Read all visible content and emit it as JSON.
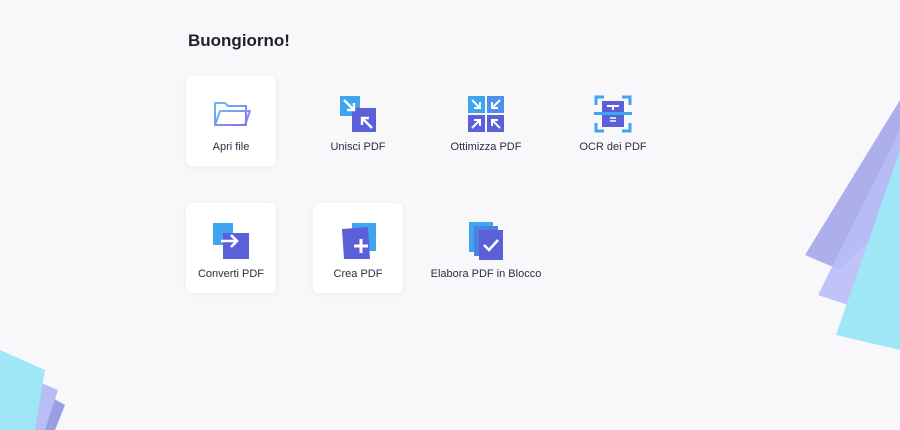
{
  "greeting": "Buongiorno!",
  "tiles": [
    {
      "label": "Apri file",
      "icon": "folder-icon"
    },
    {
      "label": "Unisci PDF",
      "icon": "merge-icon"
    },
    {
      "label": "Ottimizza PDF",
      "icon": "optimize-icon"
    },
    {
      "label": "OCR dei PDF",
      "icon": "ocr-scan-icon"
    },
    {
      "label": "Converti PDF",
      "icon": "convert-icon"
    },
    {
      "label": "Crea PDF",
      "icon": "create-plus-icon"
    },
    {
      "label": "Elabora PDF in Blocco",
      "icon": "batch-process-icon"
    }
  ],
  "colors": {
    "background": "#f8f8fb",
    "accent_blue": "#3ea5ee",
    "accent_indigo": "#5b5fd8",
    "accent_cyan": "#5ae0f0"
  }
}
